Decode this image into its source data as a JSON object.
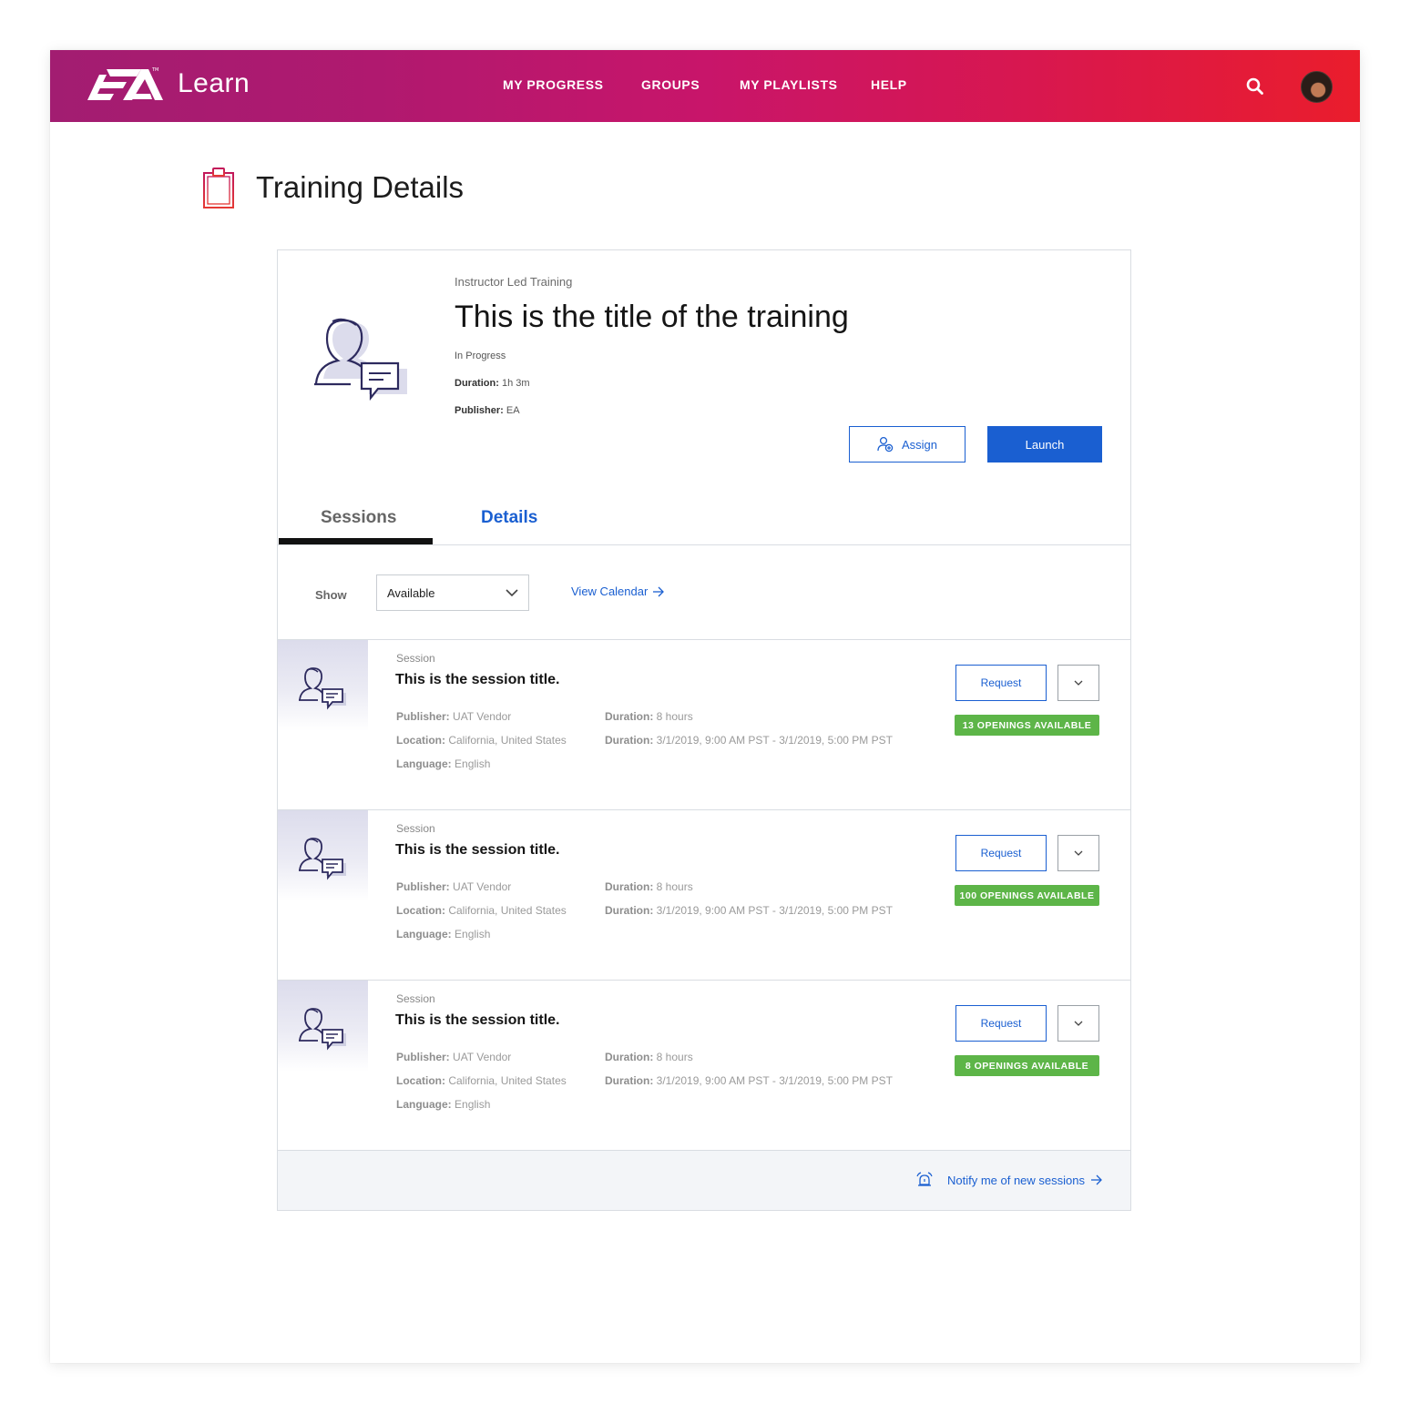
{
  "header": {
    "logo_text": "Learn",
    "nav": [
      "MY PROGRESS",
      "GROUPS",
      "MY PLAYLISTS",
      "HELP"
    ],
    "icons": {
      "search": "search-icon",
      "avatar": "user-avatar"
    },
    "gradient_colors": [
      "#a21d71",
      "#c8156a",
      "#ea1d2c"
    ]
  },
  "page": {
    "title": "Training Details",
    "title_icon": "clipboard-icon"
  },
  "training": {
    "type": "Instructor Led Training",
    "title": "This is the title of the training",
    "status": "In Progress",
    "duration_label": "Duration:",
    "duration_value": "1h 3m",
    "publisher_label": "Publisher:",
    "publisher_value": "EA",
    "assign_label": "Assign",
    "launch_label": "Launch"
  },
  "tabs": [
    "Sessions",
    "Details"
  ],
  "filter": {
    "show_label": "Show",
    "selected": "Available",
    "view_calendar": "View Calendar"
  },
  "sessions": [
    {
      "kicker": "Session",
      "title": "This is the session title.",
      "publisher_label": "Publisher:",
      "publisher": "UAT Vendor",
      "location_label": "Location:",
      "location": "California, United States",
      "language_label": "Language:",
      "language": "English",
      "duration_label": "Duration:",
      "duration": "8 hours",
      "dates_label": "Duration:",
      "dates": "3/1/2019, 9:00 AM PST - 3/1/2019, 5:00 PM PST",
      "request_label": "Request",
      "openings": "13 OPENINGS AVAILABLE"
    },
    {
      "kicker": "Session",
      "title": "This is the session title.",
      "publisher_label": "Publisher:",
      "publisher": "UAT Vendor",
      "location_label": "Location:",
      "location": "California, United States",
      "language_label": "Language:",
      "language": "English",
      "duration_label": "Duration:",
      "duration": "8 hours",
      "dates_label": "Duration:",
      "dates": "3/1/2019, 9:00 AM PST - 3/1/2019, 5:00 PM PST",
      "request_label": "Request",
      "openings": "100 OPENINGS AVAILABLE"
    },
    {
      "kicker": "Session",
      "title": "This is the session title.",
      "publisher_label": "Publisher:",
      "publisher": "UAT Vendor",
      "location_label": "Location:",
      "location": "California, United States",
      "language_label": "Language:",
      "language": "English",
      "duration_label": "Duration:",
      "duration": "8 hours",
      "dates_label": "Duration:",
      "dates": "3/1/2019, 9:00 AM PST - 3/1/2019, 5:00 PM PST",
      "request_label": "Request",
      "openings": "8 OPENINGS AVAILABLE"
    }
  ],
  "footer": {
    "notify_label": "Notify me of new sessions",
    "notify_icon": "alarm-bell-icon"
  },
  "colors": {
    "accent_blue": "#1a5fd1",
    "badge_green": "#5db548",
    "icon_navy": "#2d2a5e"
  }
}
